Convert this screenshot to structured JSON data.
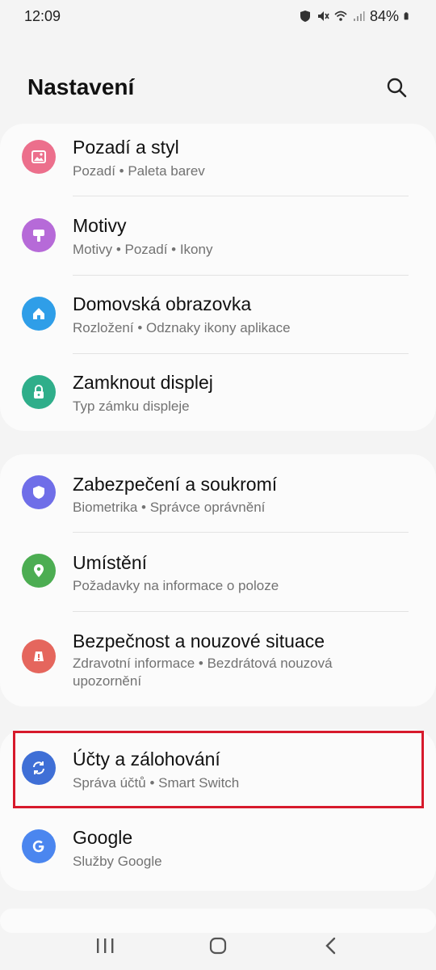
{
  "status": {
    "time": "12:09",
    "battery": "84%"
  },
  "header": {
    "title": "Nastavení"
  },
  "groups": [
    {
      "items": [
        {
          "label": "Pozadí a styl",
          "sub": "Pozadí  •  Paleta barev",
          "color": "#ec6f8c"
        },
        {
          "label": "Motivy",
          "sub": "Motivy  •  Pozadí  •  Ikony",
          "color": "#b66ad8"
        },
        {
          "label": "Domovská obrazovka",
          "sub": "Rozložení  •  Odznaky ikony aplikace",
          "color": "#2f9ee8"
        },
        {
          "label": "Zamknout displej",
          "sub": "Typ zámku displeje",
          "color": "#2fae8a"
        }
      ]
    },
    {
      "items": [
        {
          "label": "Zabezpečení a soukromí",
          "sub": "Biometrika  •  Správce oprávnění",
          "color": "#6f6ee8"
        },
        {
          "label": "Umístění",
          "sub": "Požadavky na informace o poloze",
          "color": "#4cad52"
        },
        {
          "label": "Bezpečnost a nouzové situace",
          "sub": "Zdravotní informace  •  Bezdrátová nouzová upozornění",
          "color": "#e5665d"
        }
      ]
    },
    {
      "items": [
        {
          "label": "Účty a zálohování",
          "sub": "Správa účtů  •  Smart Switch",
          "color": "#3f6fd6"
        },
        {
          "label": "Google",
          "sub": "Služby Google",
          "color": "#4b86ef"
        }
      ]
    }
  ],
  "icons": [
    "wallpaper-icon",
    "palette-brush-icon",
    "home-icon",
    "lock-icon",
    "shield-icon",
    "location-pin-icon",
    "emergency-icon",
    "sync-icon",
    "google-icon"
  ],
  "colors": {
    "highlight": "#d71a2c",
    "background": "#f4f4f4",
    "card": "#fbfbfb"
  }
}
